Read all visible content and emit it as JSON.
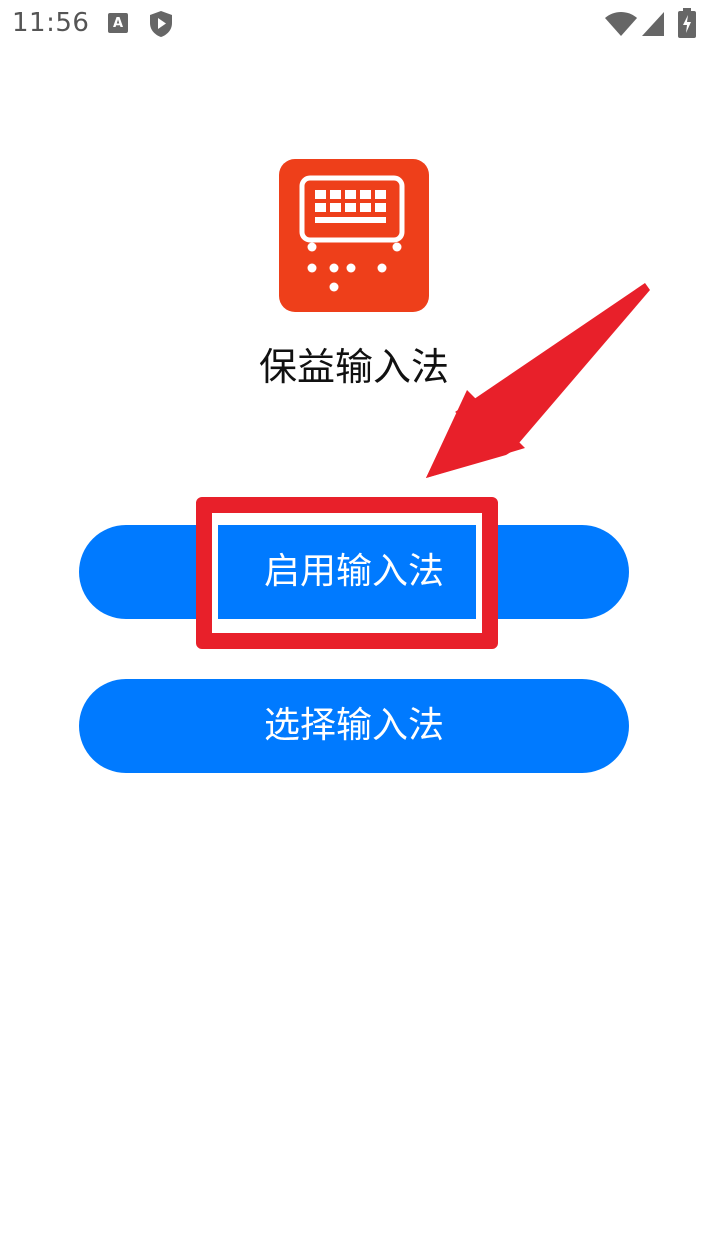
{
  "status_bar": {
    "time": "11:56",
    "left_icons": [
      "keyboard-a-icon",
      "shield-play-icon"
    ],
    "right_icons": [
      "wifi-icon",
      "signal-icon",
      "battery-charging-icon"
    ]
  },
  "app": {
    "name": "保益输入法",
    "icon": "keyboard-app-icon",
    "icon_color": "#ee3f1a"
  },
  "buttons": {
    "enable_label": "启用输入法",
    "select_label": "选择输入法",
    "color": "#007aff"
  },
  "annotation": {
    "highlight_color": "#e8202a",
    "arrow_color": "#e8202a"
  }
}
